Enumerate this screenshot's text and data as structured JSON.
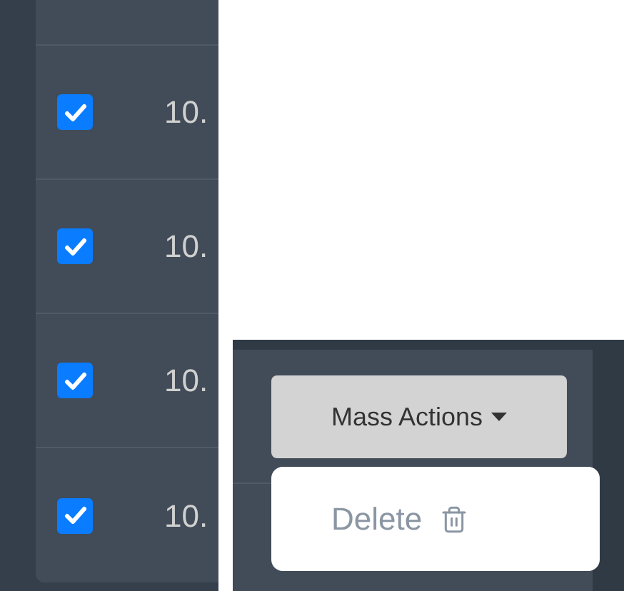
{
  "rows": [
    {
      "checked": true,
      "cell": "10."
    },
    {
      "checked": true,
      "cell": "10."
    },
    {
      "checked": true,
      "cell": "10."
    },
    {
      "checked": true,
      "cell": "10."
    }
  ],
  "mass_actions": {
    "label": "Mass Actions",
    "menu": [
      {
        "label": "Delete"
      }
    ]
  }
}
